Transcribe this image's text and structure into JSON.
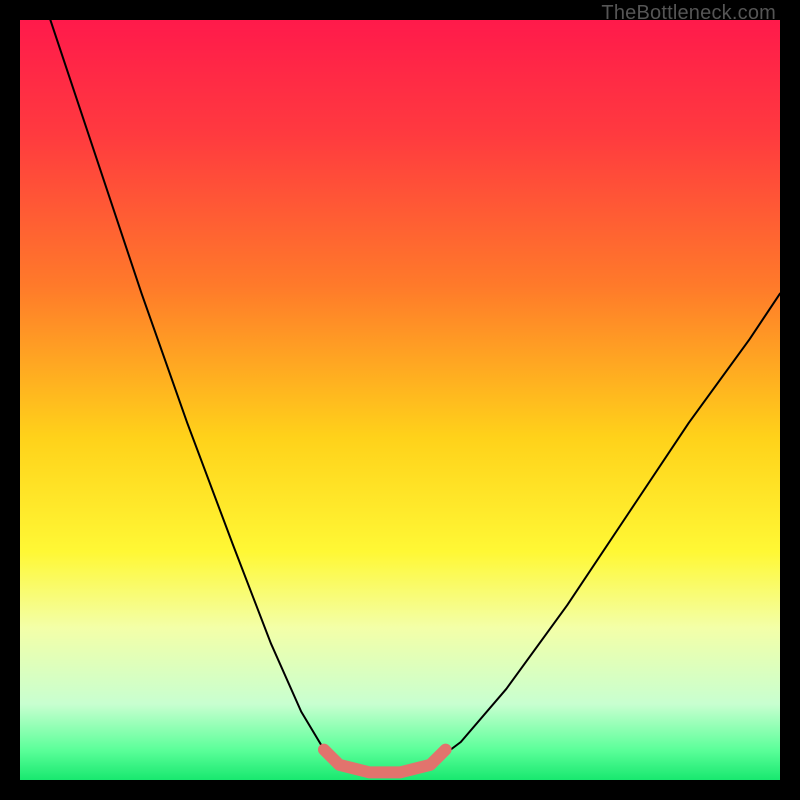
{
  "watermark": "TheBottleneck.com",
  "colors": {
    "frame": "#000000",
    "curve": "#000000",
    "highlight": "#e2736d",
    "gradient_stops": [
      {
        "offset": 0.0,
        "color": "#ff1a4b"
      },
      {
        "offset": 0.15,
        "color": "#ff3a3f"
      },
      {
        "offset": 0.35,
        "color": "#ff7a2a"
      },
      {
        "offset": 0.55,
        "color": "#ffd21a"
      },
      {
        "offset": 0.7,
        "color": "#fff835"
      },
      {
        "offset": 0.8,
        "color": "#f3ffa8"
      },
      {
        "offset": 0.9,
        "color": "#c8ffd0"
      },
      {
        "offset": 0.96,
        "color": "#5cff9a"
      },
      {
        "offset": 1.0,
        "color": "#18e86f"
      }
    ]
  },
  "chart_data": {
    "type": "line",
    "title": "",
    "xlabel": "",
    "ylabel": "",
    "xlim": [
      0,
      100
    ],
    "ylim": [
      0,
      100
    ],
    "grid": false,
    "series": [
      {
        "name": "left-branch",
        "x": [
          4,
          10,
          16,
          22,
          28,
          33,
          37,
          40,
          42
        ],
        "values": [
          100,
          82,
          64,
          47,
          31,
          18,
          9,
          4,
          2
        ]
      },
      {
        "name": "bottom-flat",
        "x": [
          42,
          46,
          50,
          54
        ],
        "values": [
          2,
          1,
          1,
          2
        ]
      },
      {
        "name": "right-branch",
        "x": [
          54,
          58,
          64,
          72,
          80,
          88,
          96,
          100
        ],
        "values": [
          2,
          5,
          12,
          23,
          35,
          47,
          58,
          64
        ]
      },
      {
        "name": "highlight-segment",
        "x": [
          40,
          42,
          46,
          50,
          54,
          56
        ],
        "values": [
          4,
          2,
          1,
          1,
          2,
          4
        ]
      }
    ],
    "annotations": []
  }
}
